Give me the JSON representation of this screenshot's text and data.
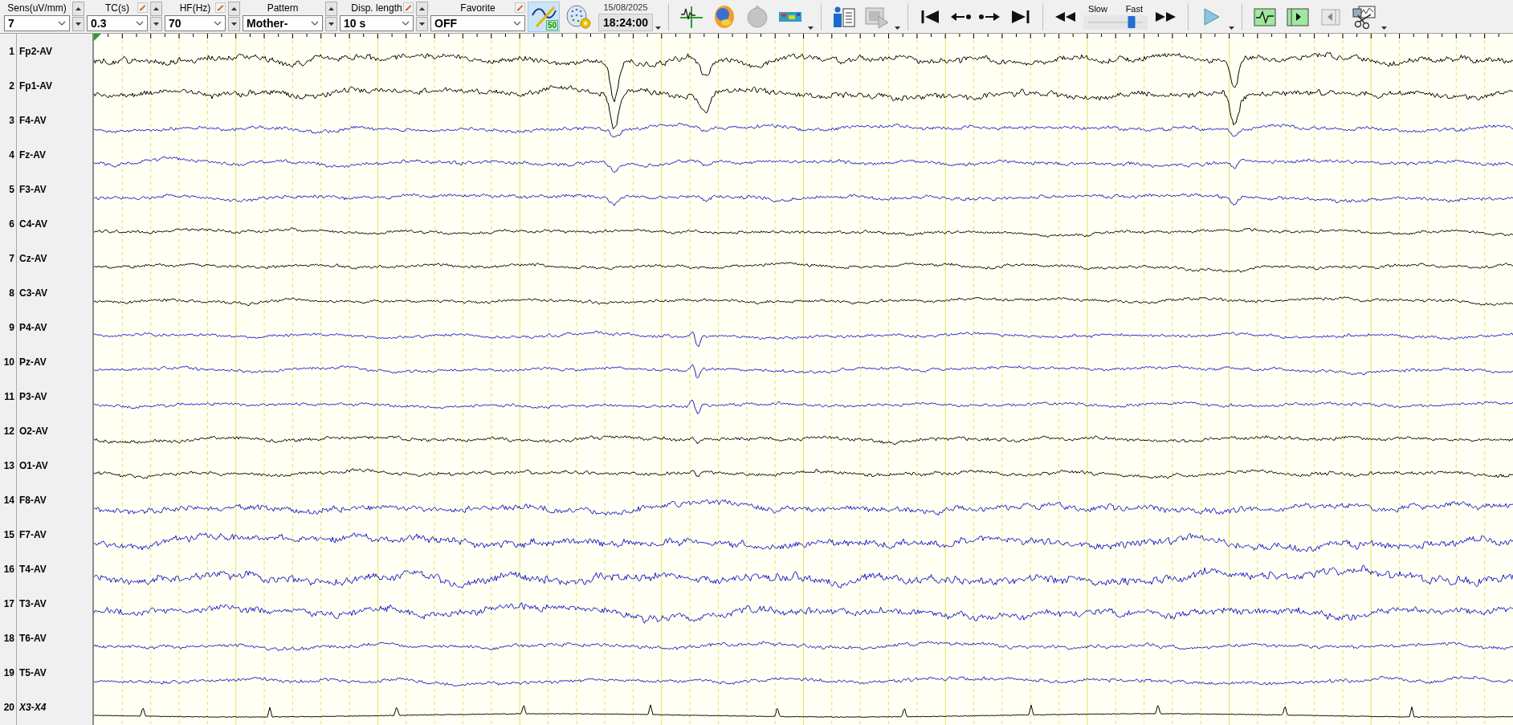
{
  "toolbar": {
    "controls": [
      {
        "label": "Sens(uV/mm)",
        "value": "7",
        "pencil": false,
        "spinner": true
      },
      {
        "label": "TC(s)",
        "value": "0.3",
        "pencil": true,
        "spinner": true
      },
      {
        "label": "HF(Hz)",
        "value": "70",
        "pencil": true,
        "spinner": true
      },
      {
        "label": "Pattern",
        "value": "Mother-",
        "pencil": false,
        "spinner": true
      },
      {
        "label": "Disp. length",
        "value": "10 s",
        "pencil": true,
        "spinner": true
      },
      {
        "label": "Favorite",
        "value": "OFF",
        "pencil": true,
        "spinner": false
      }
    ],
    "overlay_button": {
      "badge": "50",
      "selected": true
    },
    "date": "15/08/2025",
    "time": "18:24:00",
    "speed": {
      "slow_label": "Slow",
      "fast_label": "Fast",
      "level": 0.8
    }
  },
  "channels": [
    {
      "number": "1",
      "name": "Fp2-AV",
      "color": "#000000",
      "kind": "eeg"
    },
    {
      "number": "2",
      "name": "Fp1-AV",
      "color": "#000000",
      "kind": "eeg"
    },
    {
      "number": "3",
      "name": "F4-AV",
      "color": "#1c1cc8",
      "kind": "eeg"
    },
    {
      "number": "4",
      "name": "Fz-AV",
      "color": "#1c1cc8",
      "kind": "eeg"
    },
    {
      "number": "5",
      "name": "F3-AV",
      "color": "#1c1cc8",
      "kind": "eeg"
    },
    {
      "number": "6",
      "name": "C4-AV",
      "color": "#000000",
      "kind": "eeg"
    },
    {
      "number": "7",
      "name": "Cz-AV",
      "color": "#000000",
      "kind": "eeg"
    },
    {
      "number": "8",
      "name": "C3-AV",
      "color": "#000000",
      "kind": "eeg"
    },
    {
      "number": "9",
      "name": "P4-AV",
      "color": "#1c1cc8",
      "kind": "eeg"
    },
    {
      "number": "10",
      "name": "Pz-AV",
      "color": "#1c1cc8",
      "kind": "eeg"
    },
    {
      "number": "11",
      "name": "P3-AV",
      "color": "#1c1cc8",
      "kind": "eeg"
    },
    {
      "number": "12",
      "name": "O2-AV",
      "color": "#000000",
      "kind": "eeg"
    },
    {
      "number": "13",
      "name": "O1-AV",
      "color": "#000000",
      "kind": "eeg"
    },
    {
      "number": "14",
      "name": "F8-AV",
      "color": "#1c1cc8",
      "kind": "eeg"
    },
    {
      "number": "15",
      "name": "F7-AV",
      "color": "#1c1cc8",
      "kind": "eeg"
    },
    {
      "number": "16",
      "name": "T4-AV",
      "color": "#1c1cc8",
      "kind": "eeg"
    },
    {
      "number": "17",
      "name": "T3-AV",
      "color": "#1c1cc8",
      "kind": "eeg"
    },
    {
      "number": "18",
      "name": "T6-AV",
      "color": "#1c1cc8",
      "kind": "eeg"
    },
    {
      "number": "19",
      "name": "T5-AV",
      "color": "#1c1cc8",
      "kind": "eeg"
    },
    {
      "number": "20",
      "name": "X3-X4",
      "color": "#000000",
      "kind": "aux"
    }
  ]
}
